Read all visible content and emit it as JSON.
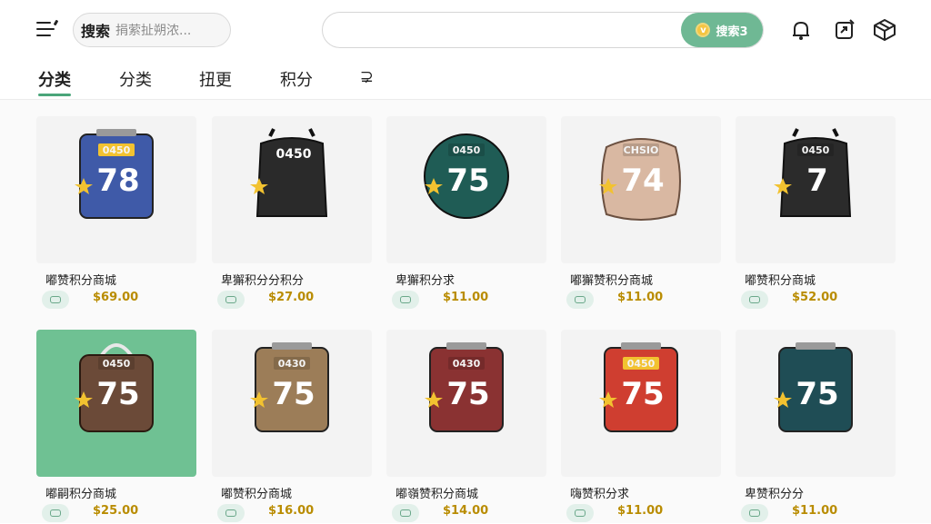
{
  "header": {
    "search_label": "搜索",
    "search_placeholder": "捐萦扯朔浓...",
    "main_search_value": "",
    "search_button_label": "搜索3",
    "coin_glyph": "v",
    "icons": [
      "bell-icon",
      "share-icon",
      "package-icon"
    ]
  },
  "tabs": [
    {
      "label": "分类",
      "active": true
    },
    {
      "label": "分类"
    },
    {
      "label": "扭更"
    },
    {
      "label": "积分"
    },
    {
      "label": "⊋"
    }
  ],
  "products": [
    {
      "name": "嘟赞积分商城",
      "price": "$69.00",
      "number": "78",
      "code": "0450",
      "color": "#3f5aa8",
      "shape": "bag"
    },
    {
      "name": "卑獬积分分积分",
      "price": "$27.00",
      "number": "0450",
      "code": "",
      "color": "#2a2a2a",
      "shape": "backpack"
    },
    {
      "name": "卑獬积分求",
      "price": "$11.00",
      "number": "75",
      "code": "0450",
      "color": "#1f5c55",
      "shape": "round"
    },
    {
      "name": "嘟獬赞积分商城",
      "price": "$11.00",
      "number": "74",
      "code": "CHSIO",
      "color": "#d9b8a2",
      "shape": "sack"
    },
    {
      "name": "嘟赞积分商城",
      "price": "$52.00",
      "number": "7",
      "code": "0450",
      "color": "#2b2b2b",
      "shape": "backpack"
    },
    {
      "name": "嘟嗣积分商城",
      "price": "$25.00",
      "number": "75",
      "code": "0450",
      "color": "#6b4a38",
      "shape": "handbag",
      "selected": true
    },
    {
      "name": "嘟赞积分商城",
      "price": "$16.00",
      "number": "75",
      "code": "0430",
      "color": "#9c7d58",
      "shape": "bag"
    },
    {
      "name": "嘟嶺赞积分商城",
      "price": "$14.00",
      "number": "75",
      "code": "0430",
      "color": "#8a3232",
      "shape": "bag"
    },
    {
      "name": "嗨赞积分求",
      "price": "$11.00",
      "number": "75",
      "code": "0450",
      "color": "#cf3e30",
      "shape": "bag"
    },
    {
      "name": "卑赞积分分",
      "price": "$11.00",
      "number": "75",
      "code": "",
      "color": "#1f4d55",
      "shape": "bag"
    }
  ]
}
